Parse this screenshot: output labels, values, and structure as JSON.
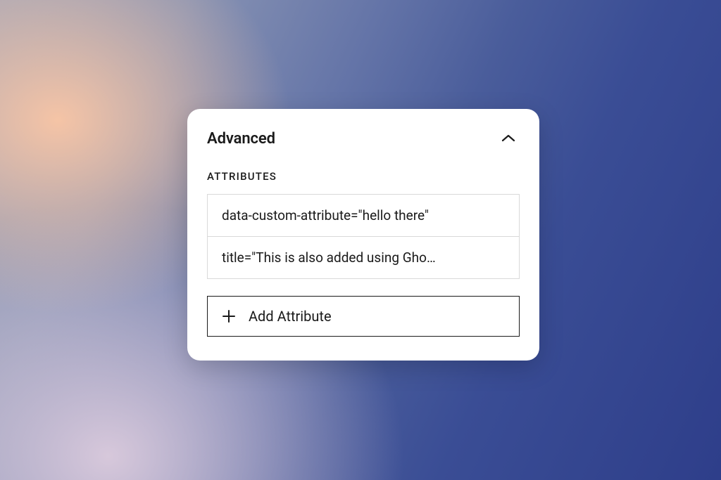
{
  "panel": {
    "title": "Advanced",
    "section_label": "ATTRIBUTES",
    "attributes": [
      "data-custom-attribute=\"hello there\"",
      "title=\"This is also added using Gho…"
    ],
    "add_button_label": "Add Attribute"
  }
}
